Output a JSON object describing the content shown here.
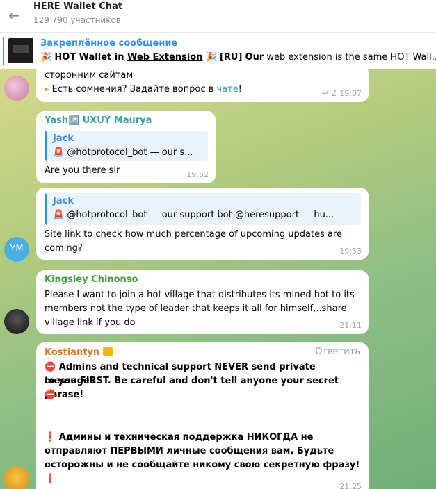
{
  "header": {
    "back_icon": "arrow-left-icon",
    "title": "HERE Wallet Chat",
    "subtitle": "129 790 участников"
  },
  "pinned": {
    "title": "Закреплённое сообщение",
    "party_icon": "🎉",
    "part1": "HOT Wallet in ",
    "part2": "Web Extension",
    "part3": "[RU]",
    "part4": "Our",
    "part5": " web extension is the same HOT Wall..."
  },
  "messages": [
    {
      "id": "m1",
      "line1": "сторонним сайтам",
      "line2_prefix": "Есть сомнения? Задайте вопрос в ",
      "line2_link": "чате",
      "line2_suffix": "!",
      "replies": "2",
      "time": "19:07"
    },
    {
      "id": "m2",
      "sender": "Yash🆙 UXUY Maurya",
      "quote_name": "Jack",
      "quote_text": "🚨 @hotprotocol_bot — our s...",
      "text": "Are you there sir",
      "time": "19:52"
    },
    {
      "id": "m3",
      "quote_name": "Jack",
      "quote_text": "🚨 @hotprotocol_bot — our support bot   @heresupport — hu...",
      "line1": "Site link to check how much percentage of upcoming updates are",
      "line2": "coming?",
      "time": "19:53",
      "avatar_initials": "YM"
    },
    {
      "id": "m4",
      "sender": "Kingsley Chinonso",
      "line1": "Please I want to join a hot village that distributes its mined hot to its",
      "line2": "members not the type of leader that keeps it all for himself,..share",
      "line3": "village link if you do",
      "time": "21:11"
    },
    {
      "id": "m5",
      "sender": "Kostiantyn",
      "reply_label": "Ответить",
      "en1": "⛔ Admins and technical support NEVER send private messages",
      "en2": "to you FIRST. Be careful and don't tell anyone your secret phrase!",
      "en3": "⛔",
      "ru1": "❗ Админы и техническая поддержка НИКОГДА не",
      "ru2": "отправляют ПЕРВЫМИ личные сообщения вам. Будьте",
      "ru3": "осторожны и не сообщайте никому свою секретную фразу!",
      "ru4": "❗",
      "time": "21:25"
    }
  ],
  "colors": {
    "accent": "#3390ec",
    "green_name": "#3a9e3a",
    "orange_name": "#e07b21",
    "teal_name": "#3aa0a0"
  }
}
